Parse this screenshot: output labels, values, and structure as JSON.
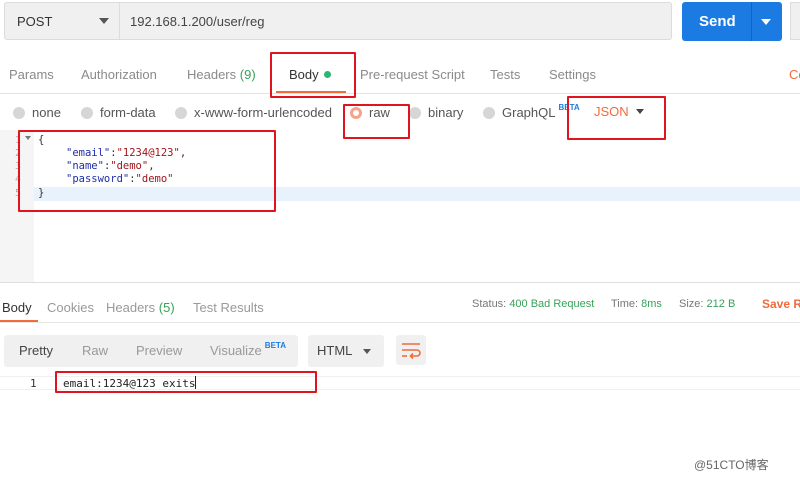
{
  "request": {
    "method": "POST",
    "url": "192.168.1.200/user/reg",
    "send_label": "Send"
  },
  "tabs": [
    {
      "label": "Params"
    },
    {
      "label": "Authorization"
    },
    {
      "label": "Headers",
      "count": "(9)"
    },
    {
      "label": "Body"
    },
    {
      "label": "Pre-request Script"
    },
    {
      "label": "Tests"
    },
    {
      "label": "Settings"
    },
    {
      "label": "Co"
    }
  ],
  "body_types": {
    "options": [
      "none",
      "form-data",
      "x-www-form-urlencoded",
      "raw",
      "binary",
      "GraphQL"
    ],
    "beta": "BETA",
    "selected": "raw",
    "format": "JSON"
  },
  "editor": {
    "line_numbers": [
      "1",
      "2",
      "3",
      "4",
      "5"
    ],
    "lines": {
      "open": "{",
      "l2_key": "\"email\"",
      "l2_val": "\"1234@123\"",
      "l3_key": "\"name\"",
      "l3_val": "\"demo\"",
      "l4_key": "\"password\"",
      "l4_val": "\"demo\"",
      "close": "}"
    }
  },
  "response": {
    "tabs": [
      {
        "label": "Body"
      },
      {
        "label": "Cookies"
      },
      {
        "label": "Headers",
        "count": "(5)"
      },
      {
        "label": "Test Results"
      }
    ],
    "status_label": "Status:",
    "status_value": "400 Bad Request",
    "time_label": "Time:",
    "time_value": "8ms",
    "size_label": "Size:",
    "size_value": "212 B",
    "save_label": "Save R",
    "view_modes": [
      "Pretty",
      "Raw",
      "Preview",
      "Visualize"
    ],
    "beta": "BETA",
    "format": "HTML",
    "line_number": "1",
    "body_text": "email:1234@123 exits"
  },
  "watermark": "@51CTO博客",
  "colors": {
    "accent": "#f26b3a",
    "send": "#1b7be3",
    "annotation": "#e0141e",
    "status_green": "#36a35a"
  }
}
